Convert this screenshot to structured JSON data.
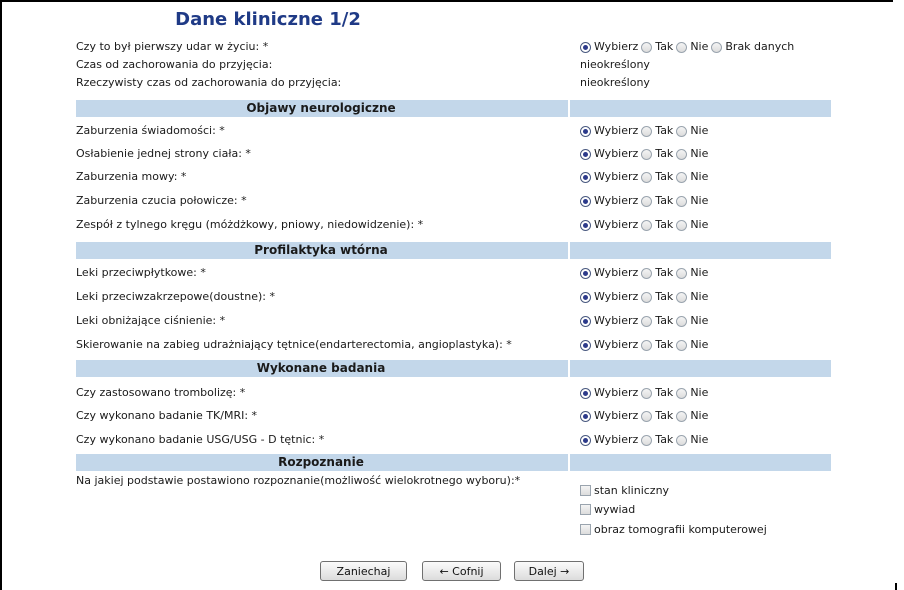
{
  "title": "Dane kliniczne 1/2",
  "radio_options_4": [
    "Wybierz",
    "Tak",
    "Nie",
    "Brak danych"
  ],
  "radio_options_3": [
    "Wybierz",
    "Tak",
    "Nie"
  ],
  "top": {
    "q1": "Czy to był pierwszy udar w życiu: *",
    "q2": "Czas od zachorowania do przyjęcia:",
    "q2_value": "nieokreślony",
    "q3": "Rzeczywisty czas od zachorowania do przyjęcia:",
    "q3_value": "nieokreślony"
  },
  "sections": {
    "neuro": "Objawy neurologiczne",
    "prof": "Profilaktyka wtórna",
    "badania": "Wykonane badania",
    "rozp": "Rozpoznanie"
  },
  "neuro_q": [
    "Zaburzenia świadomości: *",
    "Osłabienie jednej strony ciała: *",
    "Zaburzenia mowy: *",
    "Zaburzenia czucia połowicze: *",
    "Zespół z tylnego kręgu (móżdżkowy, pniowy, niedowidzenie): *"
  ],
  "prof_q": [
    "Leki przeciwpłytkowe: *",
    "Leki przeciwzakrzepowe(doustne): *",
    "Leki obniżające ciśnienie: *",
    "Skierowanie na zabieg udrażniający tętnice(endarterectomia, angioplastyka): *"
  ],
  "badania_q": [
    "Czy zastosowano trombolizę: *",
    "Czy wykonano badanie TK/MRI: *",
    "Czy wykonano badanie USG/USG - D tętnic: *"
  ],
  "rozp_q": "Na jakiej podstawie postawiono rozpoznanie(możliwość wielokrotnego wyboru):*",
  "rozp_options": [
    "stan kliniczny",
    "wywiad",
    "obraz tomografii komputerowej"
  ],
  "buttons": {
    "cancel": "Zaniechaj",
    "back": "← Cofnij",
    "next": "Dalej →"
  }
}
